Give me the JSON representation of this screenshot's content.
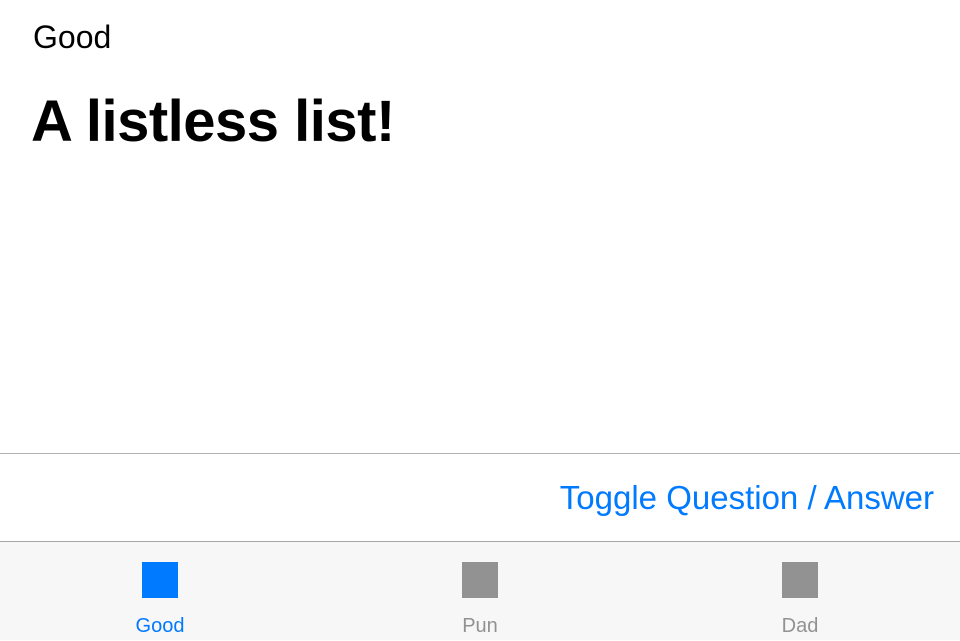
{
  "header": {
    "category": "Good"
  },
  "main": {
    "joke_text": "A listless list!"
  },
  "toolbar": {
    "toggle_label": "Toggle Question / Answer"
  },
  "tab_bar": {
    "active_color": "#007aff",
    "inactive_color": "#929292",
    "tabs": [
      {
        "label": "Good",
        "icon": "square-icon",
        "selected": true
      },
      {
        "label": "Pun",
        "icon": "square-icon",
        "selected": false
      },
      {
        "label": "Dad",
        "icon": "square-icon",
        "selected": false
      }
    ]
  }
}
